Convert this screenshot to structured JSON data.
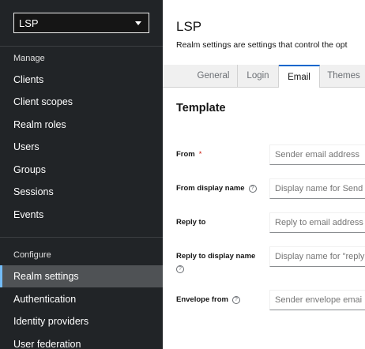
{
  "sidebar": {
    "realm_selector": "LSP",
    "manage_title": "Manage",
    "manage_items": [
      "Clients",
      "Client scopes",
      "Realm roles",
      "Users",
      "Groups",
      "Sessions",
      "Events"
    ],
    "configure_title": "Configure",
    "configure_items": [
      "Realm settings",
      "Authentication",
      "Identity providers",
      "User federation"
    ]
  },
  "header": {
    "title": "LSP",
    "description": "Realm settings are settings that control the opt"
  },
  "tabs": [
    "General",
    "Login",
    "Email",
    "Themes"
  ],
  "active_tab": "Email",
  "form": {
    "section_title": "Template",
    "from": {
      "label": "From",
      "required": "*",
      "placeholder": "Sender email address"
    },
    "from_display_name": {
      "label": "From display name",
      "placeholder": "Display name for Send"
    },
    "reply_to": {
      "label": "Reply to",
      "placeholder": "Reply to email address"
    },
    "reply_to_display_name": {
      "label": "Reply to display name",
      "placeholder": "Display name for \"reply"
    },
    "envelope_from": {
      "label": "Envelope from",
      "placeholder": "Sender envelope emai"
    }
  },
  "icons": {
    "help": "help-circle-icon",
    "dropdown": "caret-down-icon"
  },
  "colors": {
    "sidebar_bg": "#212427",
    "active_nav": "#4f5255",
    "active_accent": "#73bcf7",
    "tab_accent": "#0066cc",
    "required": "#c9190b"
  }
}
